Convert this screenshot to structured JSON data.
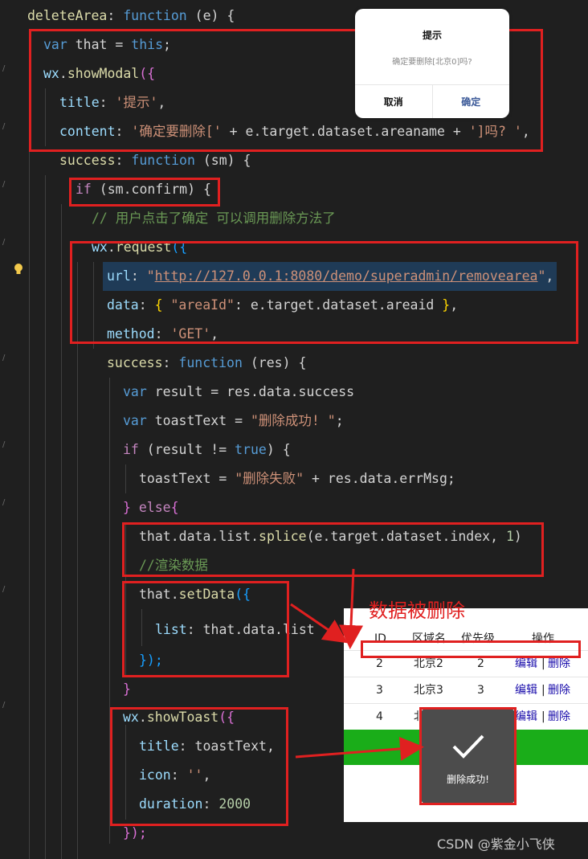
{
  "code": {
    "l1": {
      "name": "deleteArea",
      "colon": ": ",
      "kw": "function",
      "rest": " (e) {"
    },
    "l2": {
      "kw": "var",
      "mid": " that = ",
      "kw2": "this",
      "end": ";"
    },
    "l3": {
      "obj": "wx",
      "dot": ".",
      "fn": "showModal",
      "open": "({"
    },
    "l4": {
      "key": "title",
      "colon": ": ",
      "str": "'提示'",
      "end": ","
    },
    "l5": {
      "key": "content",
      "colon": ": ",
      "str1": "'确定要删除['",
      "mid": " + e.target.dataset.areaname + ",
      "str2": "']吗? '",
      "end": ","
    },
    "l6": {
      "key": "success",
      "colon": ": ",
      "kw": "function",
      "rest": " (sm) {"
    },
    "l7": {
      "kw": "if",
      "rest": " (sm.confirm) {"
    },
    "l8": {
      "text": "// 用户点击了确定 可以调用删除方法了"
    },
    "l9": {
      "obj": "wx",
      "dot": ".",
      "fn": "request",
      "open": "({"
    },
    "l10": {
      "key": "url",
      "colon": ": ",
      "q1": "\"",
      "url": "http://127.0.0.1:8080/demo/superadmin/removearea",
      "q2": "\"",
      "end": ","
    },
    "l11": {
      "key": "data",
      "colon": ": ",
      "open": "{ ",
      "str": "\"areaId\"",
      "mid": ": e.target.dataset.areaid ",
      "close": "}",
      "end": ","
    },
    "l12": {
      "key": "method",
      "colon": ": ",
      "str": "'GET'",
      "end": ","
    },
    "l13": {
      "key": "success",
      "colon": ": ",
      "kw": "function",
      "rest": " (res) {"
    },
    "l14": {
      "kw": "var",
      "rest": " result = res.data.success"
    },
    "l15": {
      "kw": "var",
      "mid": " toastText = ",
      "str": "\"删除成功! \"",
      "end": ";"
    },
    "l16": {
      "kw": "if",
      "mid": " (result != ",
      "bool": "true",
      "end": ") {"
    },
    "l17": {
      "mid": "toastText = ",
      "str": "\"删除失败\"",
      "end": " + res.data.errMsg;"
    },
    "l18": {
      "close": "}",
      "kw": " else",
      "open": "{"
    },
    "l19": {
      "mid": "that.data.list.",
      "fn": "splice",
      "rest": "(e.target.dataset.index, ",
      "num": "1",
      "end": ")"
    },
    "l20": {
      "text": "//渲染数据"
    },
    "l21": {
      "mid": "that.",
      "fn": "setData",
      "open": "({"
    },
    "l22": {
      "key": "list",
      "rest": ": that.data.list"
    },
    "l23": {
      "close": "});"
    },
    "l24": {
      "close": "}"
    },
    "l25": {
      "obj": "wx",
      "dot": ".",
      "fn": "showToast",
      "open": "({"
    },
    "l26": {
      "key": "title",
      "rest": ": toastText,"
    },
    "l27": {
      "key": "icon",
      "colon": ": ",
      "str": "''",
      "end": ","
    },
    "l28": {
      "key": "duration",
      "colon": ": ",
      "num": "2000"
    },
    "l29": {
      "close": "});"
    }
  },
  "modal": {
    "title": "提示",
    "content": "确定要删除[北京0]吗?",
    "cancel": "取消",
    "confirm": "确定"
  },
  "annotation": {
    "caption": "数据被删除"
  },
  "table": {
    "headers": [
      "ID",
      "区域名",
      "优先级",
      "操作"
    ],
    "rows": [
      {
        "id": "2",
        "name": "北京2",
        "priority": "2",
        "edit": "编辑",
        "sep": "|",
        "del": "删除"
      },
      {
        "id": "3",
        "name": "北京3",
        "priority": "3",
        "edit": "编辑",
        "sep": "|",
        "del": "删除"
      },
      {
        "id": "4",
        "name": "北",
        "priority": "",
        "edit": "编辑",
        "sep": "|",
        "del": "删除"
      }
    ]
  },
  "toast": {
    "text": "删除成功!",
    "icon": "checkmark-icon"
  },
  "watermark": "CSDN @紫金小飞侠",
  "colors": {
    "annotation_red": "#e02020",
    "green_button": "#1aad19",
    "toast_bg": "#4c4c4c"
  }
}
